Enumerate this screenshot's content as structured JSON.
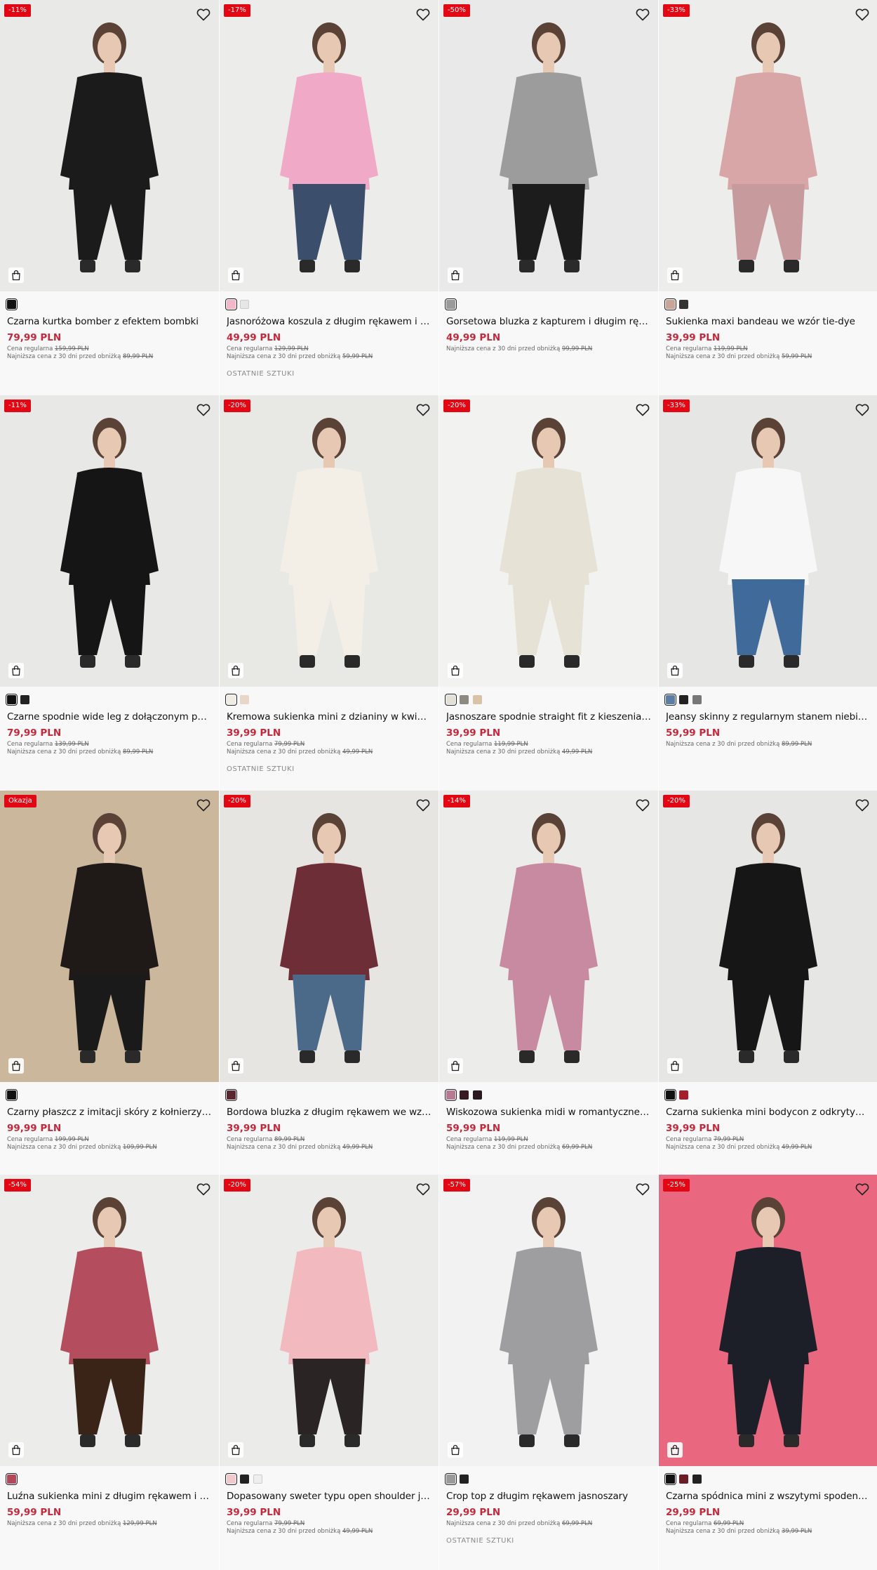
{
  "currency_labels": {
    "regular": "Cena regularna",
    "lowest": "Najniższa cena z 30 dni przed obniżką"
  },
  "products": [
    {
      "badge": "-11%",
      "name": "Czarna kurtka bomber z efektem bombki",
      "price": "79,99 PLN",
      "regular": "159,99 PLN",
      "lowest": "89,99 PLN",
      "last_items": "",
      "swatches": [
        "#111111"
      ],
      "bg": "#e9e9e7",
      "figure": "#1b1b1b",
      "figure2": "#1b1b1b"
    },
    {
      "badge": "-17%",
      "name": "Jasnoróżowa koszula z długim rękawem i haf...",
      "price": "49,99 PLN",
      "regular": "129,99 PLN",
      "lowest": "59,99 PLN",
      "last_items": "OSTATNIE SZTUKI",
      "swatches": [
        "#f2b8c9",
        "#e6e6e6"
      ],
      "bg": "#ececeb",
      "figure": "#f0a9c6",
      "figure2": "#3b4f6d"
    },
    {
      "badge": "-50%",
      "name": "Gorsetowa bluzka z kapturem i długim ręka...",
      "price": "49,99 PLN",
      "regular": "",
      "lowest": "99,99 PLN",
      "last_items": "",
      "swatches": [
        "#9a9a9a"
      ],
      "bg": "#e9e9e9",
      "figure": "#9c9c9c",
      "figure2": "#1c1c1c"
    },
    {
      "badge": "-33%",
      "name": "Sukienka maxi bandeau we wzór tie-dye",
      "price": "39,99 PLN",
      "regular": "119,99 PLN",
      "lowest": "59,99 PLN",
      "last_items": "",
      "swatches": [
        "#c9a49a",
        "#333333"
      ],
      "bg": "#ededec",
      "figure": "#d9a6a8",
      "figure2": "#c79a9e"
    },
    {
      "badge": "-11%",
      "name": "Czarne spodnie wide leg z dołączonym paski...",
      "price": "79,99 PLN",
      "regular": "139,99 PLN",
      "lowest": "89,99 PLN",
      "last_items": "",
      "swatches": [
        "#111111",
        "#222222"
      ],
      "bg": "#e8e8e6",
      "figure": "#151515",
      "figure2": "#151515"
    },
    {
      "badge": "-20%",
      "name": "Kremowa sukienka mini z dzianiny w kwiaty",
      "price": "39,99 PLN",
      "regular": "79,99 PLN",
      "lowest": "49,99 PLN",
      "last_items": "OSTATNIE SZTUKI",
      "swatches": [
        "#f1ece2",
        "#e9d6c9"
      ],
      "bg": "#e8e8e5",
      "figure": "#f4efe6",
      "figure2": "#f4efe6"
    },
    {
      "badge": "-20%",
      "name": "Jasnoszare spodnie straight fit z kieszeniami...",
      "price": "39,99 PLN",
      "regular": "119,99 PLN",
      "lowest": "49,99 PLN",
      "last_items": "",
      "swatches": [
        "#e3e0d8",
        "#8e8a82",
        "#d9c2a8"
      ],
      "bg": "#f2f2f1",
      "figure": "#e7e2d6",
      "figure2": "#e7e2d6"
    },
    {
      "badge": "-33%",
      "name": "Jeansy skinny z regularnym stanem niebies...",
      "price": "59,99 PLN",
      "regular": "",
      "lowest": "89,99 PLN",
      "last_items": "",
      "swatches": [
        "#5c7ea6",
        "#222222",
        "#777777"
      ],
      "bg": "#e6e6e5",
      "figure": "#f7f7f7",
      "figure2": "#3f6a99"
    },
    {
      "badge": "Okazja",
      "name": "Czarny płaszcz z imitacji skóry z kołnierzykiem",
      "price": "99,99 PLN",
      "regular": "199,99 PLN",
      "lowest": "109,99 PLN",
      "last_items": "",
      "swatches": [
        "#111111"
      ],
      "bg": "#cbb79c",
      "figure": "#1f1a18",
      "figure2": "#1a1a1a"
    },
    {
      "badge": "-20%",
      "name": "Bordowa bluzka z długim rękawem we wzór...",
      "price": "39,99 PLN",
      "regular": "89,99 PLN",
      "lowest": "49,99 PLN",
      "last_items": "",
      "swatches": [
        "#5a2630"
      ],
      "bg": "#e7e5e2",
      "figure": "#6e2e38",
      "figure2": "#4b6a8a"
    },
    {
      "badge": "-14%",
      "name": "Wiskozowa sukienka midi w romantyczne k...",
      "price": "59,99 PLN",
      "regular": "119,99 PLN",
      "lowest": "69,99 PLN",
      "last_items": "",
      "swatches": [
        "#b77a93",
        "#3a1a22",
        "#2a1a20"
      ],
      "bg": "#ececeb",
      "figure": "#c78aa0",
      "figure2": "#c78aa0"
    },
    {
      "badge": "-20%",
      "name": "Czarna sukienka mini bodycon z odkrytym r...",
      "price": "39,99 PLN",
      "regular": "79,99 PLN",
      "lowest": "49,99 PLN",
      "last_items": "",
      "swatches": [
        "#111111",
        "#a51e2c"
      ],
      "bg": "#e6e6e4",
      "figure": "#161616",
      "figure2": "#161616"
    },
    {
      "badge": "-54%",
      "name": "Luźna sukienka mini z długim rękawem i hal...",
      "price": "59,99 PLN",
      "regular": "",
      "lowest": "129,99 PLN",
      "last_items": "",
      "swatches": [
        "#b2485a"
      ],
      "bg": "#ececea",
      "figure": "#b44e5e",
      "figure2": "#3a2418"
    },
    {
      "badge": "-20%",
      "name": "Dopasowany sweter typu open shoulder jas...",
      "price": "39,99 PLN",
      "regular": "79,99 PLN",
      "lowest": "49,99 PLN",
      "last_items": "",
      "swatches": [
        "#f0c9cc",
        "#222222",
        "#eeeeee"
      ],
      "bg": "#ebebea",
      "figure": "#f2b9be",
      "figure2": "#2b2424"
    },
    {
      "badge": "-57%",
      "name": "Crop top z długim rękawem jasnoszary",
      "price": "29,99 PLN",
      "regular": "",
      "lowest": "69,99 PLN",
      "last_items": "OSTATNIE SZTUKI",
      "swatches": [
        "#9a9a9a",
        "#222222"
      ],
      "bg": "#f2f2f2",
      "figure": "#9e9ea0",
      "figure2": "#9e9ea0"
    },
    {
      "badge": "-25%",
      "name": "Czarna spódnica mini z wszytymi spodenkami",
      "price": "29,99 PLN",
      "regular": "69,99 PLN",
      "lowest": "39,99 PLN",
      "last_items": "",
      "swatches": [
        "#111111",
        "#6b1d26",
        "#222222"
      ],
      "bg": "#e9687f",
      "figure": "#1c1f28",
      "figure2": "#1c1f28"
    }
  ]
}
